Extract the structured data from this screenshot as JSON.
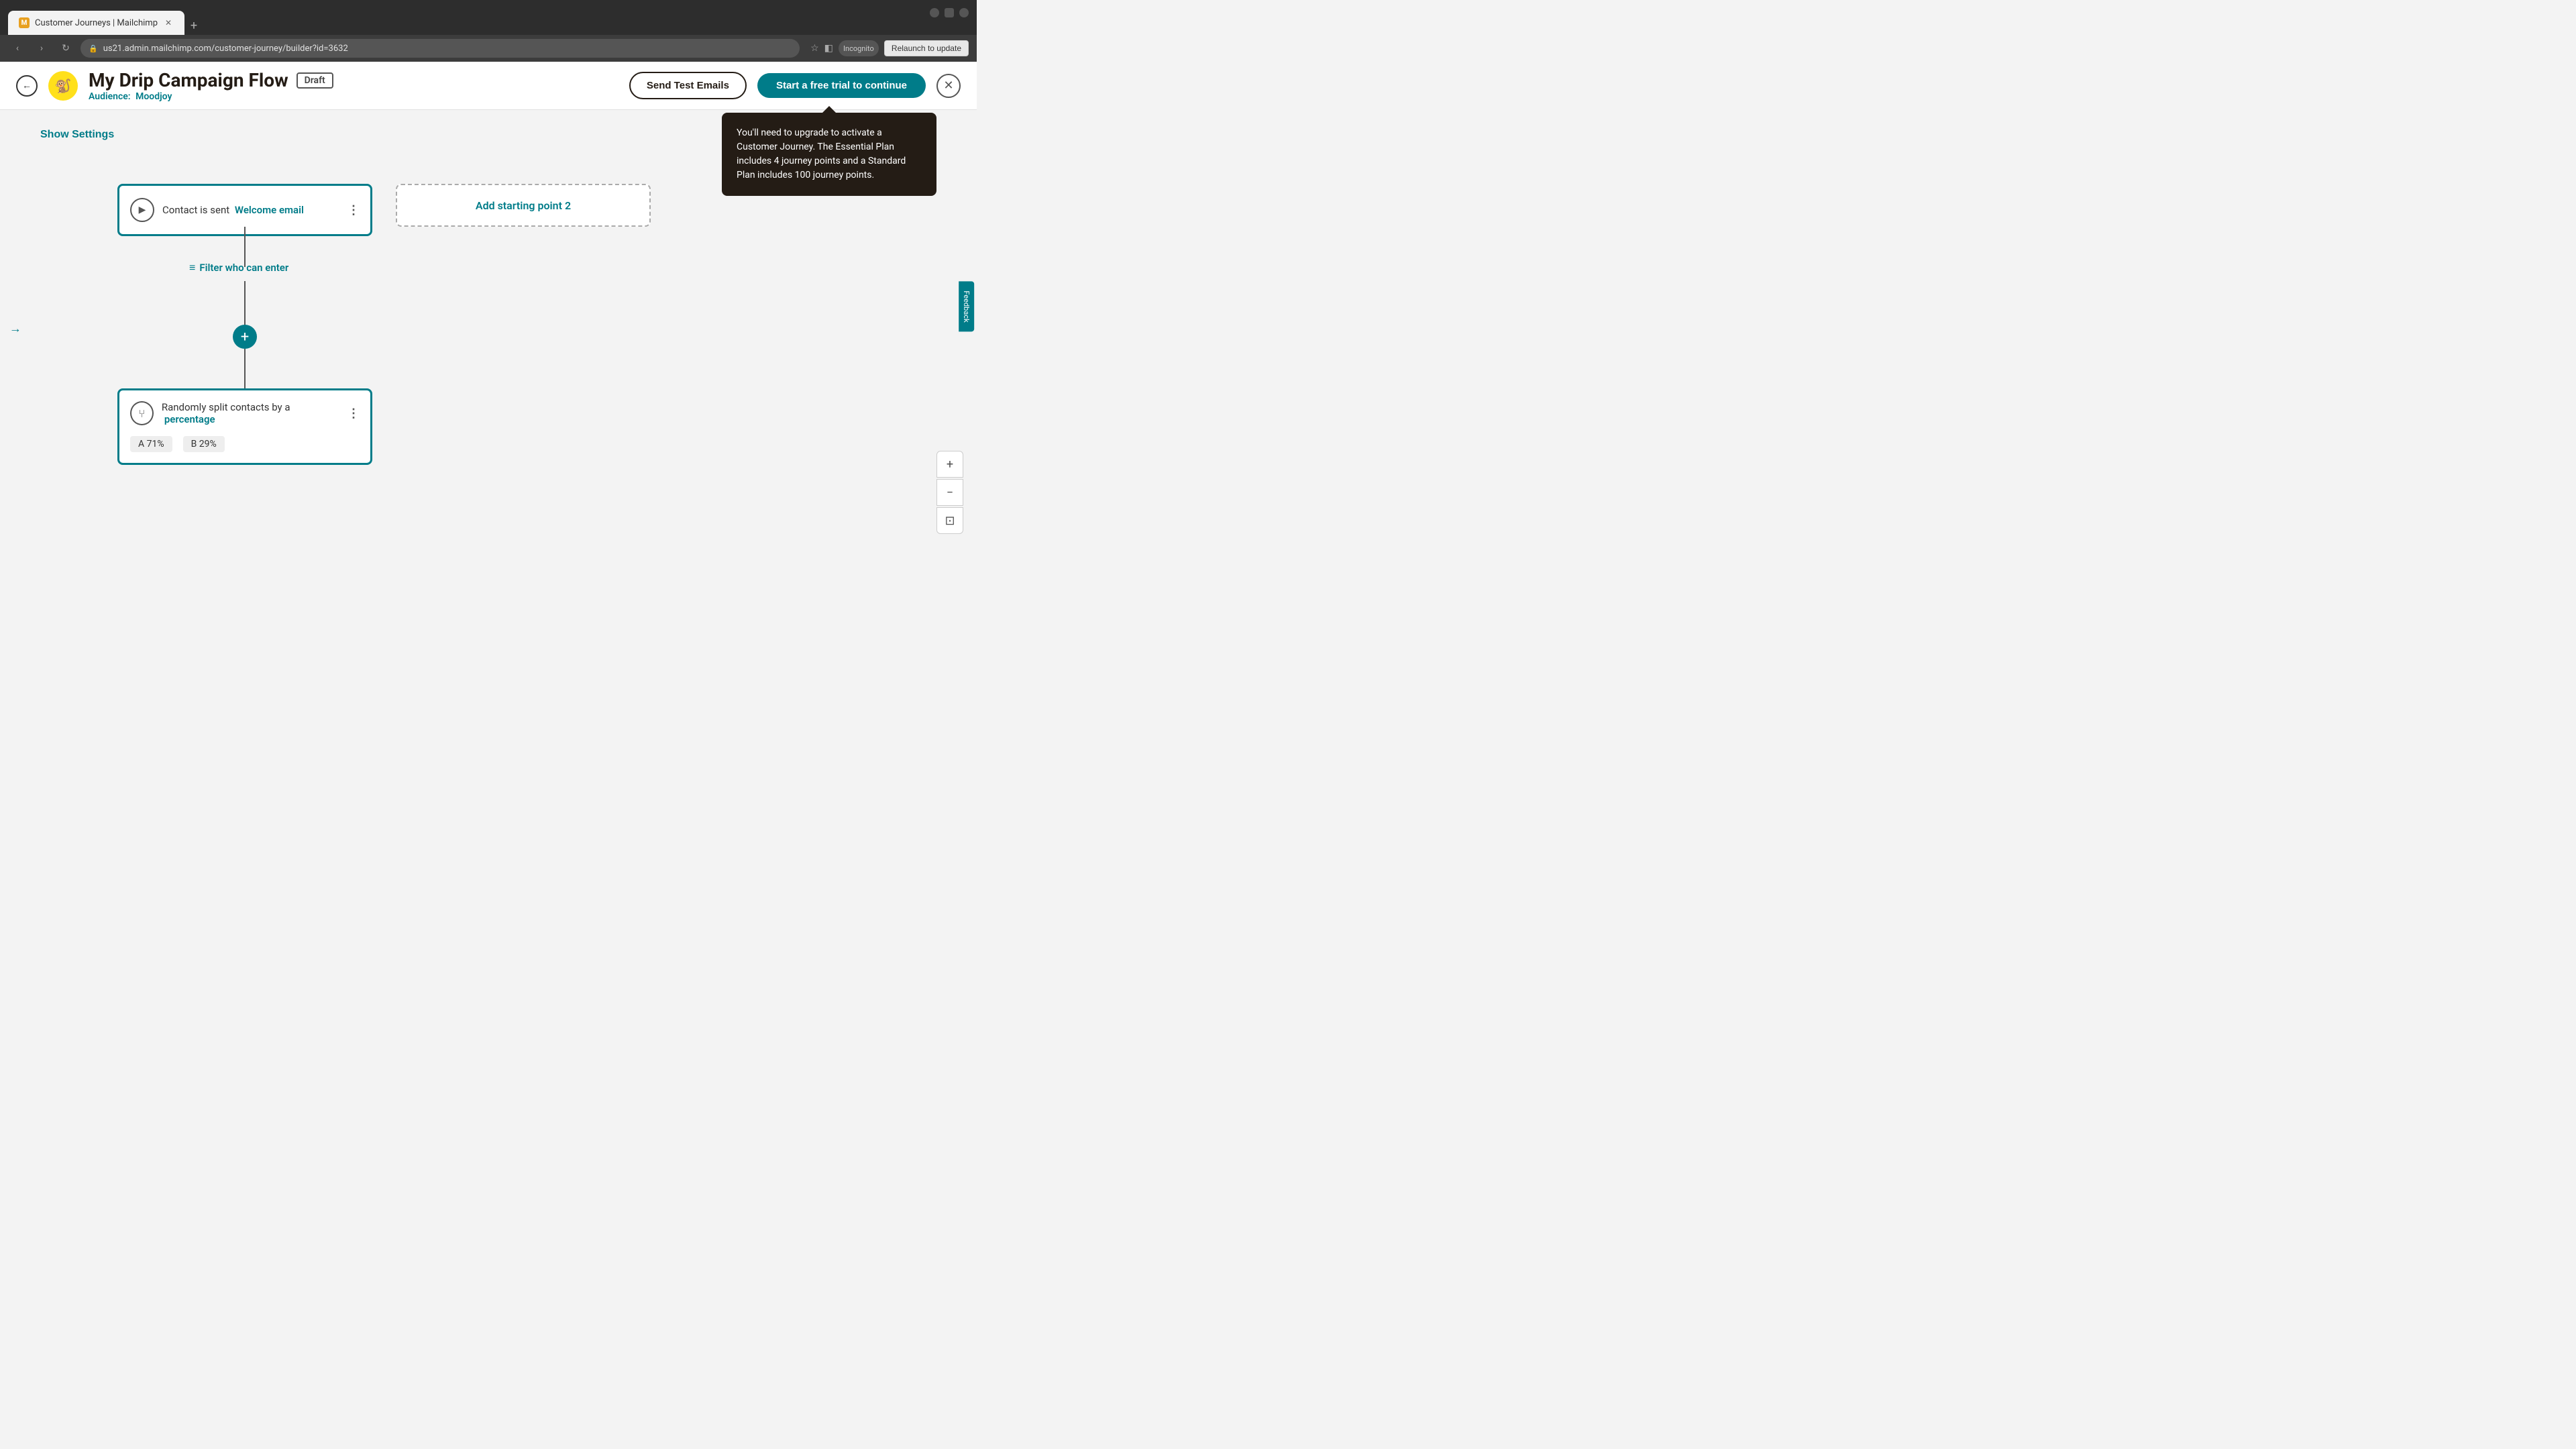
{
  "browser": {
    "tab_title": "Customer Journeys | Mailchimp",
    "url": "us21.admin.mailchimp.com/customer-journey/builder?id=3632",
    "profile_label": "Incognito",
    "relaunch_label": "Relaunch to update"
  },
  "header": {
    "back_label": "←",
    "campaign_name": "My Drip Campaign Flow",
    "draft_label": "Draft",
    "audience_label": "Audience:",
    "audience_name": "Moodjoy",
    "send_test_label": "Send Test Emails",
    "start_trial_label": "Start a free trial to continue",
    "close_label": "✕"
  },
  "canvas": {
    "show_settings_label": "Show Settings",
    "expand_icon": "→"
  },
  "tooltip": {
    "text": "You'll need to upgrade to activate a Customer Journey. The Essential Plan includes 4 journey points and a Standard Plan includes 100 journey points."
  },
  "nodes": {
    "starting_point_1": {
      "trigger_text": "Contact is sent",
      "trigger_highlight": "Welcome email",
      "menu": "⋮"
    },
    "starting_point_2_label": "Add starting point 2",
    "filter_label": "Filter who can enter",
    "split_node": {
      "text": "Randomly split contacts by a",
      "highlight": "percentage",
      "menu": "⋮",
      "a_label": "A 71%",
      "b_label": "B 29%"
    }
  },
  "zoom": {
    "plus": "+",
    "minus": "−",
    "fit": "⊡"
  },
  "feedback": {
    "label": "Feedback"
  }
}
